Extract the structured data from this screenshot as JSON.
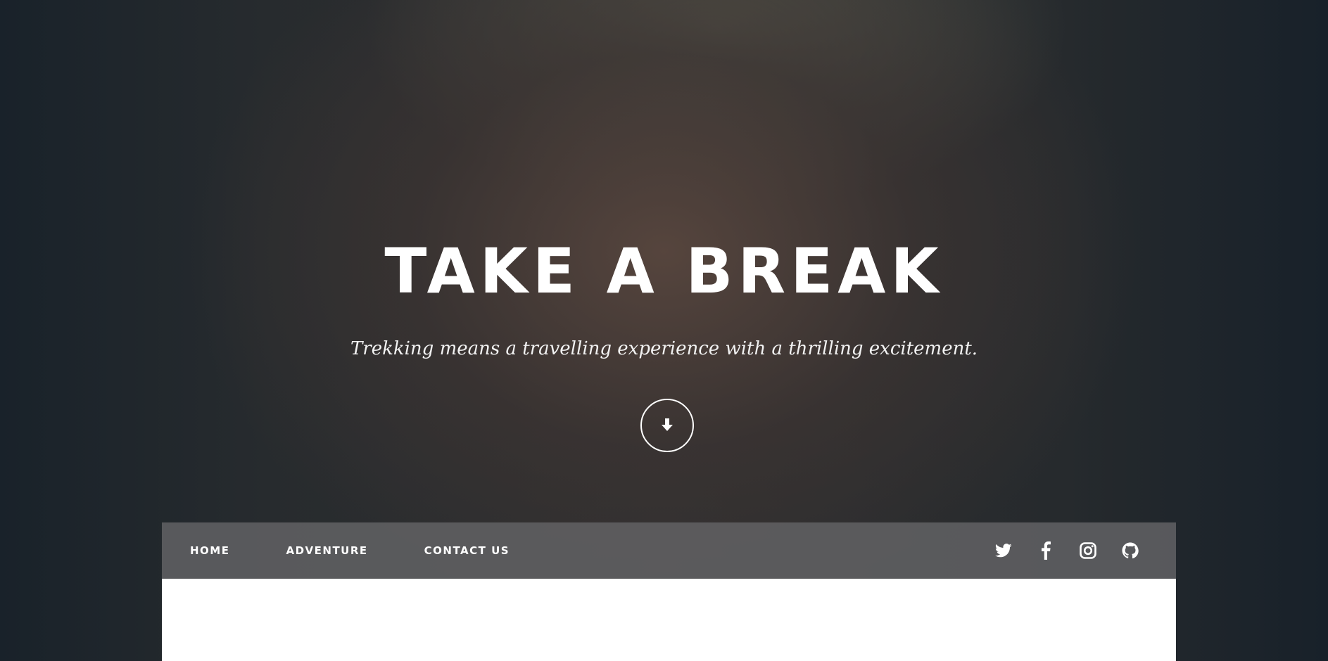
{
  "hero": {
    "title": "TAKE A BREAK",
    "subtitle": "Trekking means a travelling experience with a thrilling excitement.",
    "scroll_icon": "arrow-down-icon"
  },
  "nav": {
    "items": [
      {
        "label": "HOME"
      },
      {
        "label": "ADVENTURE"
      },
      {
        "label": "CONTACT US"
      }
    ],
    "social": [
      {
        "icon": "twitter-icon"
      },
      {
        "icon": "facebook-icon"
      },
      {
        "icon": "instagram-icon"
      },
      {
        "icon": "github-icon"
      }
    ]
  },
  "colors": {
    "text": "#ffffff",
    "navbar_bg": "#646466",
    "panel_bg": "#ffffff"
  }
}
